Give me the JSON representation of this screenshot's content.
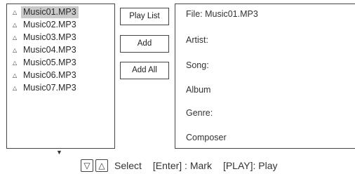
{
  "file_list": {
    "items": [
      {
        "label": "Music01.MP3",
        "selected": true
      },
      {
        "label": "Music02.MP3",
        "selected": false
      },
      {
        "label": "Music03.MP3",
        "selected": false
      },
      {
        "label": "Music04.MP3",
        "selected": false
      },
      {
        "label": "Music05.MP3",
        "selected": false
      },
      {
        "label": "Music06.MP3",
        "selected": false
      },
      {
        "label": "Music07.MP3",
        "selected": false
      }
    ],
    "item_icon": "triangle-up-icon",
    "scroll_icon": "triangle-down-icon"
  },
  "buttons": {
    "play_list": "Play List",
    "add": "Add",
    "add_all": "Add All"
  },
  "info": {
    "file": "File: Music01.MP3",
    "artist": "Artist:",
    "song": "Song:",
    "album": "Album",
    "genre": "Genre:",
    "composer": "Composer"
  },
  "footer": {
    "down_key": "▽",
    "up_key": "△",
    "select": "Select",
    "enter_mark": "[Enter] : Mark",
    "play": "[PLAY]: Play"
  }
}
